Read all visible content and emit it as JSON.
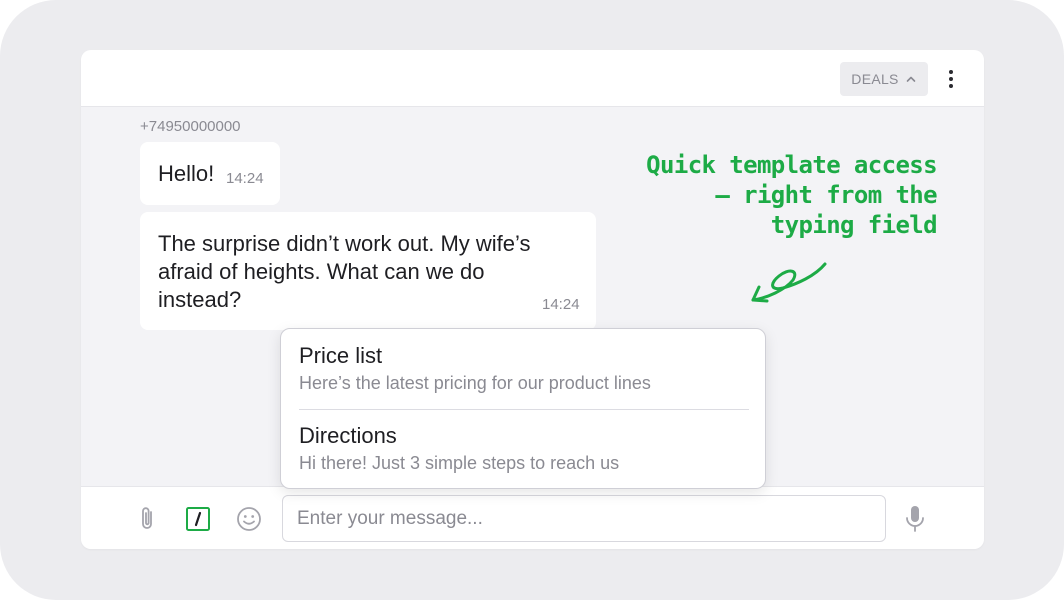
{
  "header": {
    "deals_label": "DEALS"
  },
  "chat": {
    "sender": "+74950000000",
    "messages": [
      {
        "text": "Hello!",
        "time": "14:24"
      },
      {
        "text": "The surprise didn’t work out. My wife’s afraid of heights. What can we do instead?",
        "time": "14:24"
      }
    ]
  },
  "annotation": {
    "text": "Quick template access — right from the typing field",
    "color": "#1dab46"
  },
  "templates": [
    {
      "title": "Price list",
      "preview": "Here’s the latest pricing for our product lines"
    },
    {
      "title": "Directions",
      "preview": "Hi there! Just 3 simple steps to reach us"
    }
  ],
  "composer": {
    "placeholder": "Enter your message...",
    "icons": [
      "paperclip-icon",
      "template-slash-icon",
      "emoji-icon",
      "microphone-icon"
    ],
    "accent": "#1dab46"
  }
}
